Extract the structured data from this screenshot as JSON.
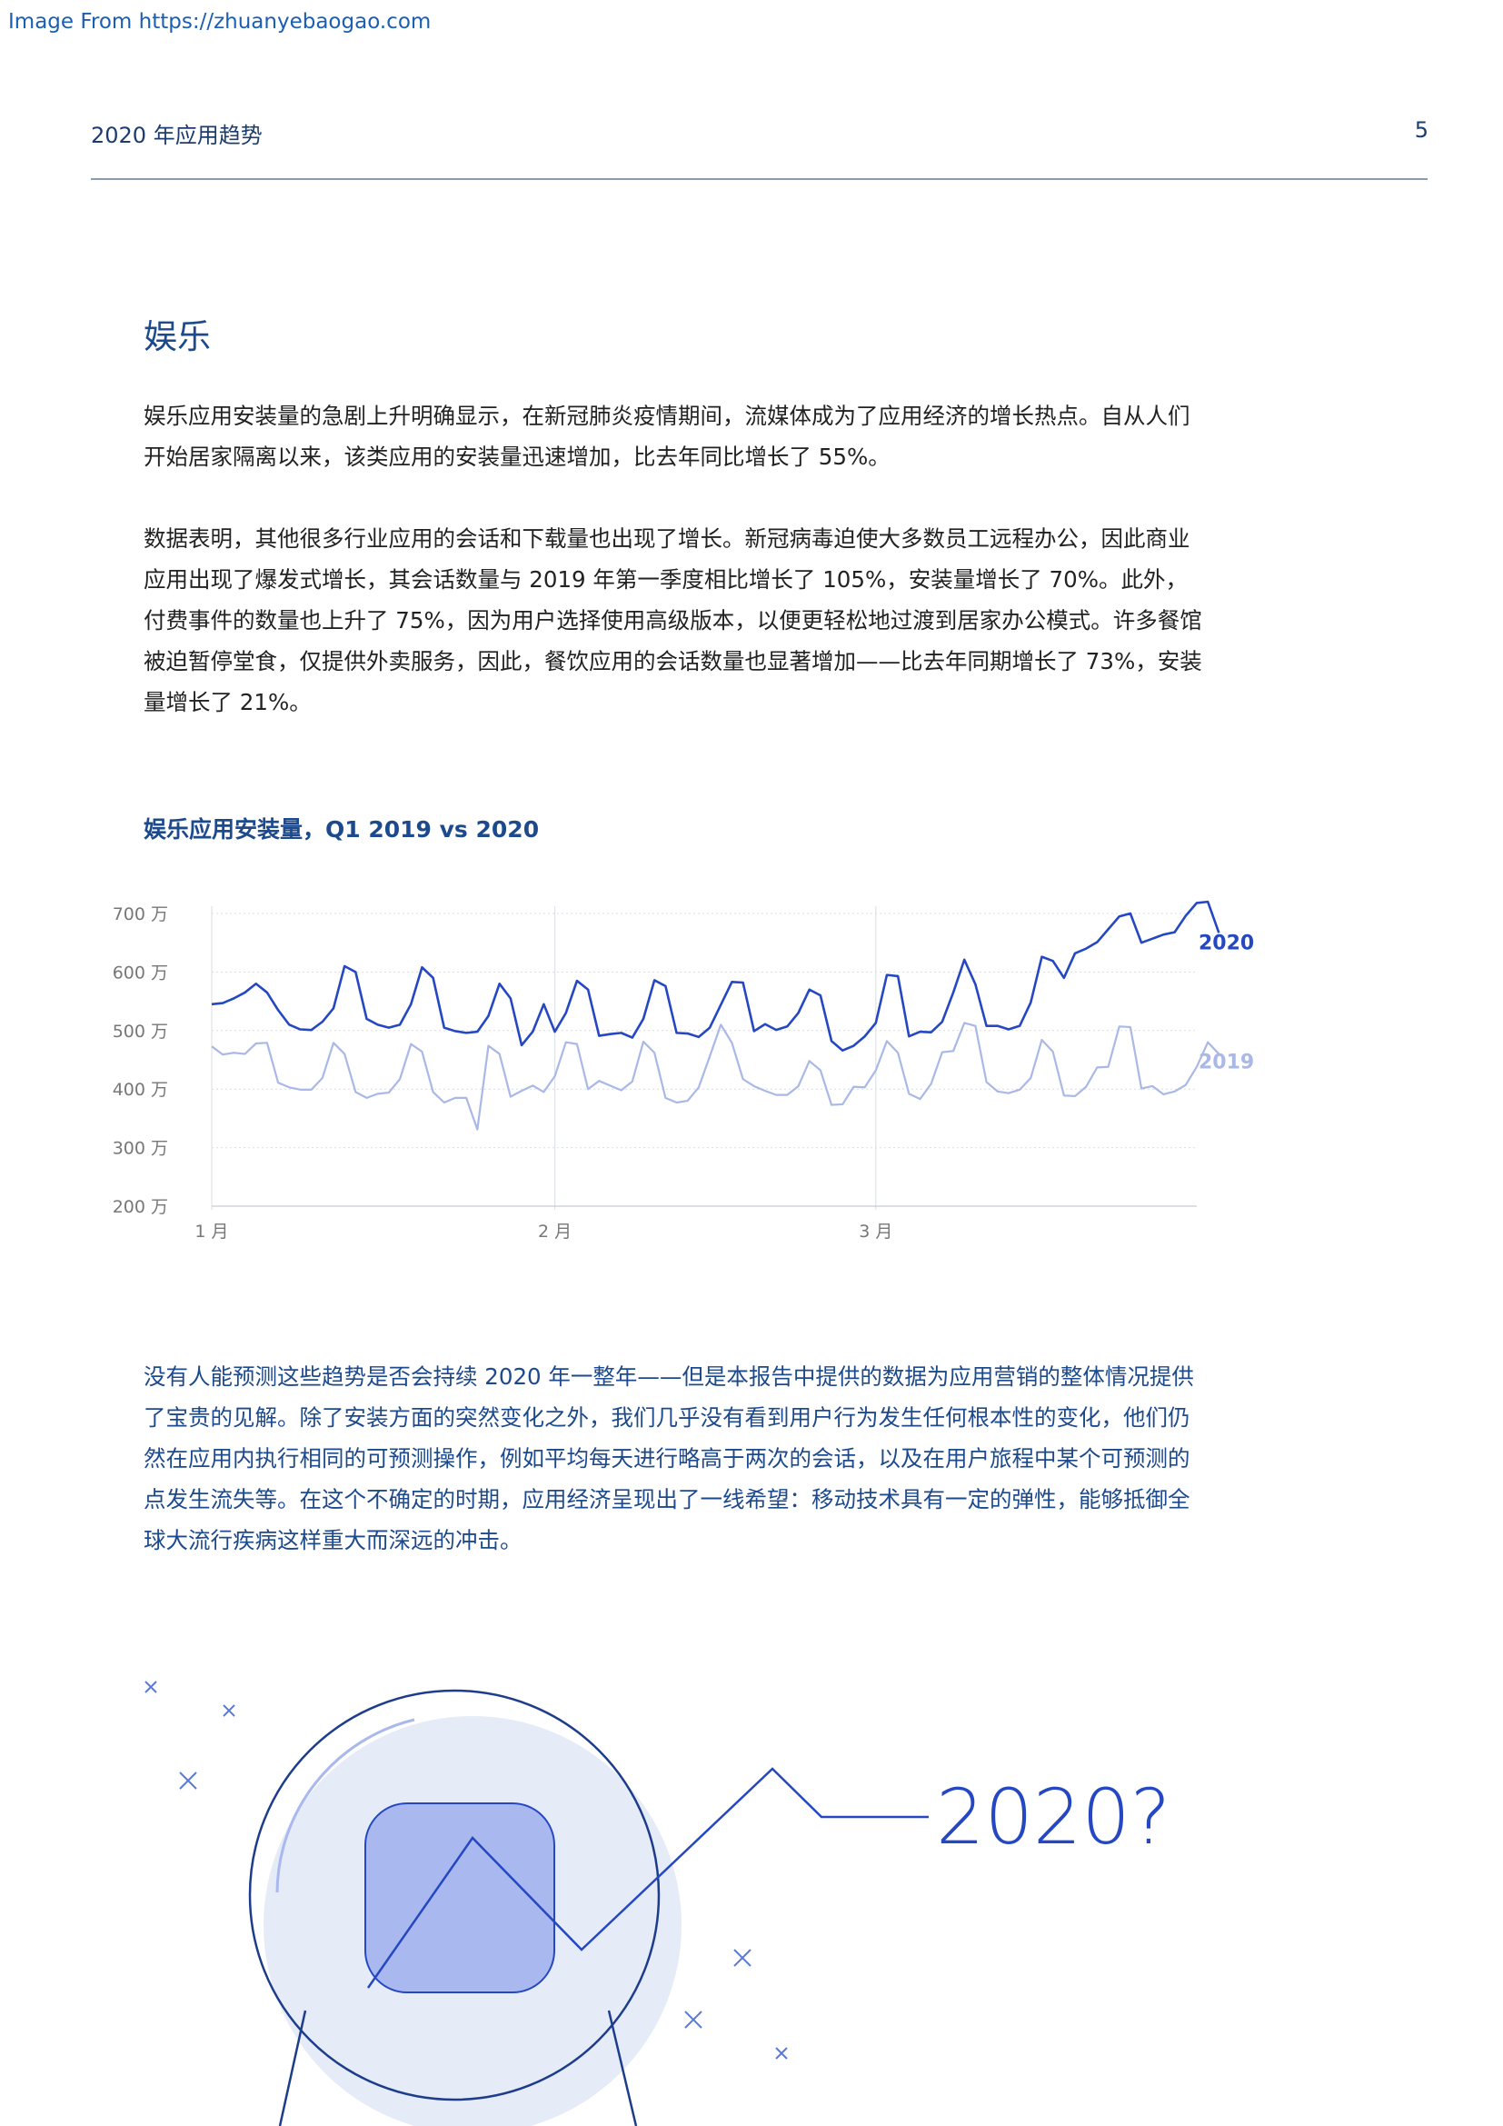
{
  "watermark": "Image From https://zhuanyebaogao.com",
  "header": {
    "title": "2020 年应用趋势",
    "page_number": "5"
  },
  "section": {
    "title": "娱乐",
    "paragraphs": [
      "娱乐应用安装量的急剧上升明确显示，在新冠肺炎疫情期间，流媒体成为了应用经济的增长热点。自从人们开始居家隔离以来，该类应用的安装量迅速增加，比去年同比增长了 55%。",
      "数据表明，其他很多行业应用的会话和下载量也出现了增长。新冠病毒迫使大多数员工远程办公，因此商业应用出现了爆发式增长，其会话数量与 2019 年第一季度相比增长了 105%，安装量增长了 70%。此外，付费事件的数量也上升了 75%，因为用户选择使用高级版本，以便更轻松地过渡到居家办公模式。许多餐馆被迫暂停堂食，仅提供外卖服务，因此，餐饮应用的会话数量也显著增加——比去年同期增长了 73%，安装量增长了 21%。"
    ]
  },
  "closing_paragraph": "没有人能预测这些趋势是否会持续 2020 年一整年——但是本报告中提供的数据为应用营销的整体情况提供了宝贵的见解。除了安装方面的突然变化之外，我们几乎没有看到用户行为发生任何根本性的变化，他们仍然在应用内执行相同的可预测操作，例如平均每天进行略高于两次的会话，以及在用户旅程中某个可预测的点发生流失等。在这个不确定的时期，应用经济呈现出了一线希望：移动技术具有一定的弹性，能够抵御全球大流行疾病这样重大而深远的冲击。",
  "illustration_text": "2020?",
  "colors": {
    "series_2020": "#2548c2",
    "series_2019": "#a9b8e6",
    "accent": "#1d4a8c",
    "illus_fill": "#e6ebf8",
    "illus_box": "#a9b8ef"
  },
  "chart_data": {
    "type": "line",
    "title": "娱乐应用安装量，Q1 2019 vs 2020",
    "ylim": [
      2000000,
      7000000
    ],
    "y_ticks": [
      {
        "value": 7000000,
        "label": "700 万"
      },
      {
        "value": 6000000,
        "label": "600 万"
      },
      {
        "value": 5000000,
        "label": "500 万"
      },
      {
        "value": 4000000,
        "label": "400 万"
      },
      {
        "value": 3000000,
        "label": "300 万"
      },
      {
        "value": 2000000,
        "label": "200 万"
      }
    ],
    "x_ticks": [
      {
        "day": 1,
        "label": "1 月"
      },
      {
        "day": 32,
        "label": "2 月"
      },
      {
        "day": 61,
        "label": "3 月"
      }
    ],
    "xlim": [
      1,
      90
    ],
    "grid": true,
    "legend": "inline-right",
    "series": [
      {
        "name": "2020",
        "values": [
          5450000,
          5470000,
          5550000,
          5650000,
          5800000,
          5650000,
          5350000,
          5100000,
          5020000,
          5010000,
          5150000,
          5380000,
          6100000,
          6000000,
          5200000,
          5100000,
          5050000,
          5100000,
          5450000,
          6080000,
          5900000,
          5050000,
          4990000,
          4960000,
          4980000,
          5250000,
          5800000,
          5550000,
          4750000,
          4980000,
          5450000,
          4980000,
          5300000,
          5850000,
          5700000,
          4910000,
          4940000,
          4960000,
          4880000,
          5200000,
          5860000,
          5760000,
          4960000,
          4950000,
          4890000,
          5050000,
          5440000,
          5830000,
          5820000,
          4990000,
          5110000,
          5010000,
          5070000,
          5300000,
          5700000,
          5600000,
          4820000,
          4660000,
          4740000,
          4900000,
          5130000,
          5950000,
          5930000,
          4900000,
          4980000,
          4970000,
          5150000,
          5650000,
          6210000,
          5790000,
          5080000,
          5080000,
          5020000,
          5080000,
          5480000,
          6260000,
          6190000,
          5900000,
          6320000,
          6400000,
          6510000,
          6730000,
          6950000,
          7000000,
          6500000,
          6570000,
          6640000,
          6680000,
          6960000,
          7180000,
          7200000,
          6670000
        ],
        "label": "2020"
      },
      {
        "name": "2019",
        "values": [
          4730000,
          4590000,
          4620000,
          4600000,
          4780000,
          4790000,
          4110000,
          4030000,
          3990000,
          3990000,
          4190000,
          4790000,
          4600000,
          3950000,
          3850000,
          3920000,
          3940000,
          4170000,
          4770000,
          4640000,
          3950000,
          3770000,
          3850000,
          3850000,
          3310000,
          4740000,
          4600000,
          3870000,
          3970000,
          4060000,
          3950000,
          4220000,
          4800000,
          4770000,
          4000000,
          4140000,
          4060000,
          3980000,
          4130000,
          4810000,
          4620000,
          3850000,
          3770000,
          3800000,
          4030000,
          4560000,
          5100000,
          4790000,
          4170000,
          4050000,
          3970000,
          3900000,
          3900000,
          4050000,
          4480000,
          4320000,
          3730000,
          3740000,
          4040000,
          4030000,
          4320000,
          4820000,
          4620000,
          3920000,
          3830000,
          4090000,
          4630000,
          4650000,
          5130000,
          5080000,
          4120000,
          3960000,
          3930000,
          3990000,
          4190000,
          4840000,
          4640000,
          3890000,
          3880000,
          4040000,
          4370000,
          4380000,
          5070000,
          5060000,
          4010000,
          4050000,
          3910000,
          3960000,
          4070000,
          4380000,
          4800000,
          4600000
        ],
        "label": "2019"
      }
    ]
  }
}
